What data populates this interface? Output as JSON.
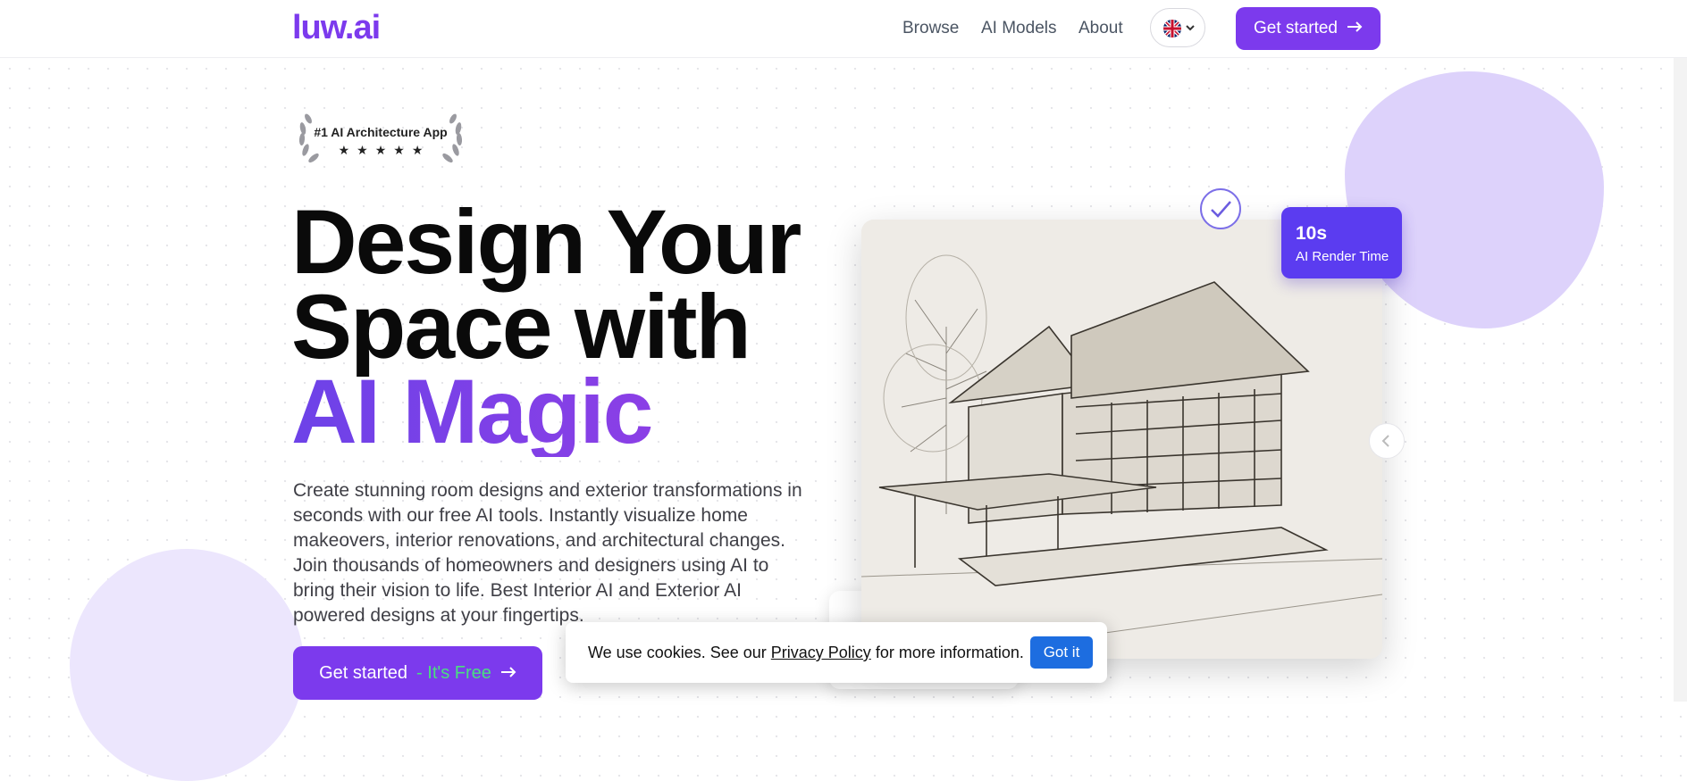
{
  "brand": {
    "logo": "luw.ai",
    "accent": "#7c3aed"
  },
  "nav": {
    "links": [
      "Browse",
      "AI Models",
      "About"
    ],
    "language_icon": "uk-flag-icon",
    "cta_label": "Get started"
  },
  "hero": {
    "badge_title": "#1 AI Architecture App",
    "badge_stars": "★★★★★",
    "headline_line1": "Design Your",
    "headline_line2": "Space with",
    "headline_accent": "AI Magic",
    "description": "Create stunning room designs and exterior transformations in seconds with our free AI tools. Instantly visualize home makeovers, interior renovations, and architectural changes. Join thousands of homeowners and designers using AI to bring their vision to life. Best Interior AI and Exterior AI powered designs at your fingertips.",
    "cta_label": "Get started",
    "cta_suffix": "- It's Free"
  },
  "showcase": {
    "stat_value": "10s",
    "stat_label": "AI Render Time",
    "image_icon": "house-sketch-illustration"
  },
  "cookie": {
    "text_before": "We use cookies. See our ",
    "link": "Privacy Policy",
    "text_after": " for more information.",
    "button": "Got it"
  }
}
